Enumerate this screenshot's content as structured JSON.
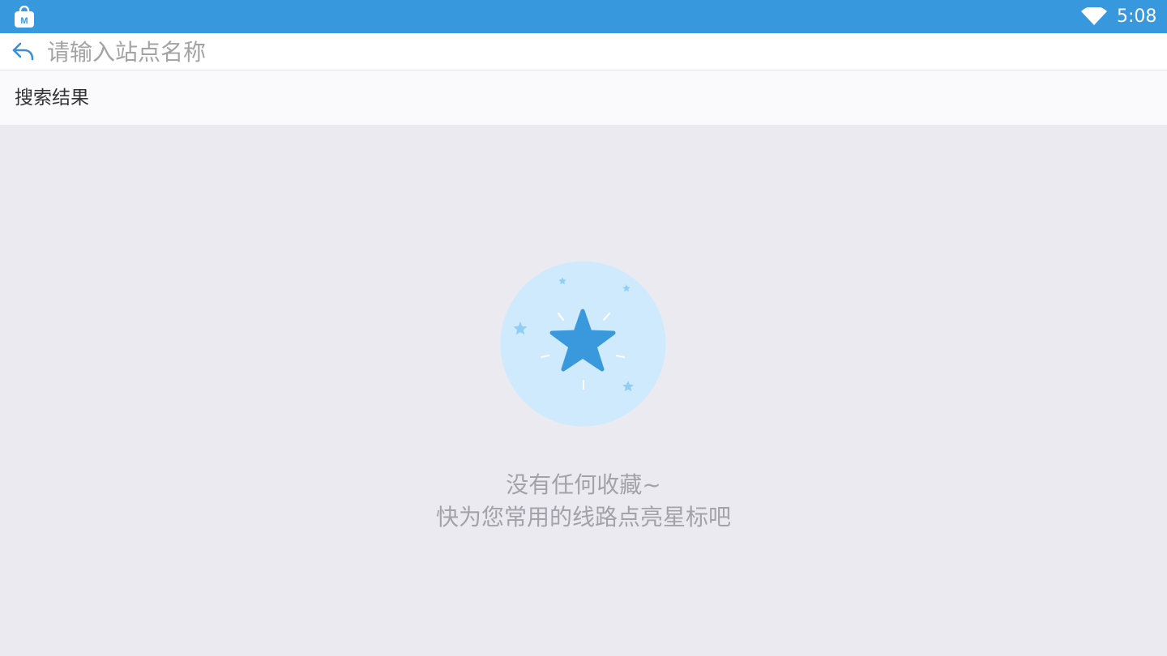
{
  "status_bar": {
    "time": "5:08",
    "app_icon": "shopping-bag-icon",
    "wifi_icon": "wifi-icon",
    "color": "#3898dd"
  },
  "search": {
    "back_icon": "back-arrow-icon",
    "placeholder": "请输入站点名称",
    "value": ""
  },
  "results": {
    "header": "搜索结果"
  },
  "empty_state": {
    "icon": "star-icon",
    "title": "没有任何收藏~",
    "subtitle": "快为您常用的线路点亮星标吧",
    "star_color": "#3a98dc",
    "circle_color": "#cfeafd"
  }
}
